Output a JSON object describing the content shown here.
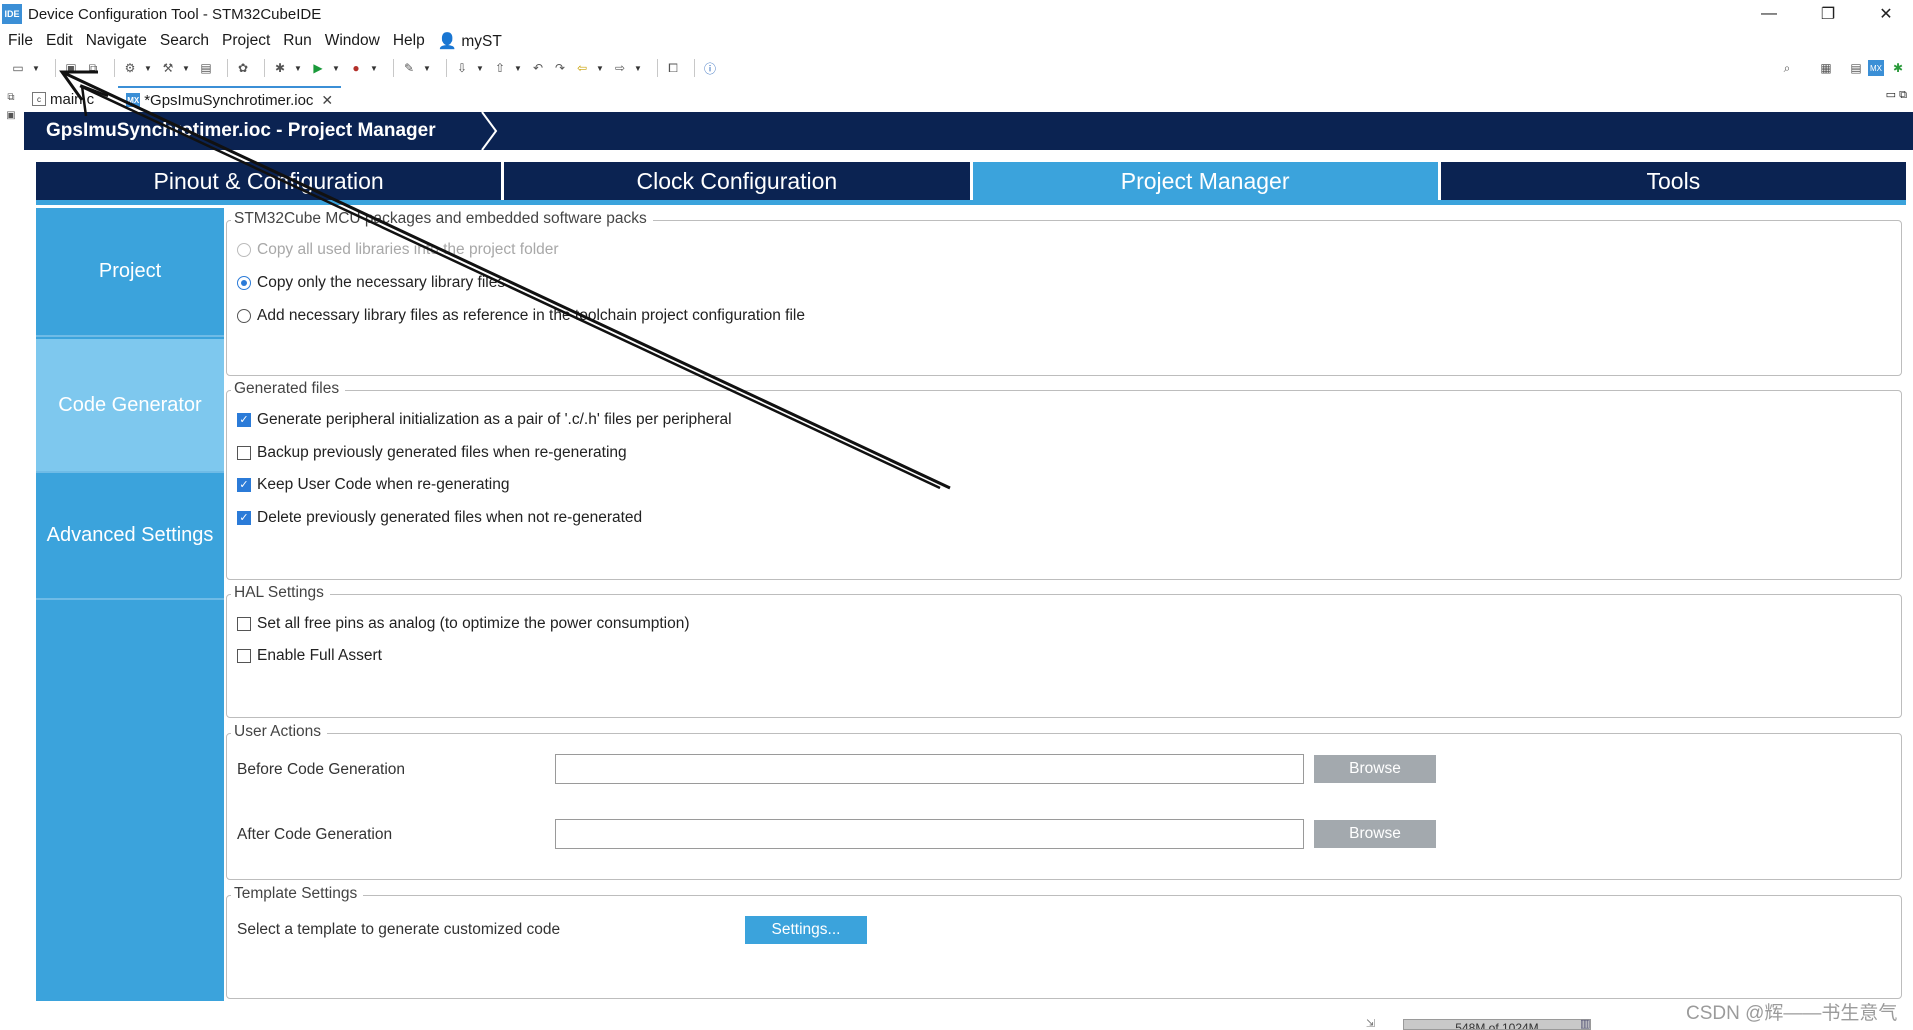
{
  "window": {
    "app_icon_text": "IDE",
    "title": "Device Configuration Tool - STM32CubeIDE",
    "minimize_glyph": "—",
    "maximize_glyph": "❐",
    "close_glyph": "✕"
  },
  "menu": {
    "items": [
      "File",
      "Edit",
      "Navigate",
      "Search",
      "Project",
      "Run",
      "Window",
      "Help"
    ],
    "myst": "myST"
  },
  "toolbar": {
    "icons": [
      "new-icon",
      "save-icon",
      "save-all-icon",
      "build-icon",
      "hammer-icon",
      "debug-icon",
      "run-icon",
      "external-tools-icon",
      "next-annotation-icon",
      "back-icon",
      "forward-icon",
      "open-perspective-icon",
      "info-icon",
      "search-icon"
    ]
  },
  "editor_tabs": {
    "main_tab": "main.c",
    "ioc_tab": "*GpsImuSynchrotimer.ioc",
    "close_glyph": "✕",
    "c_icon_text": "c",
    "mx_icon_text": "MX"
  },
  "header": {
    "breadcrumb": "GpsImuSynchrotimer.ioc - Project Manager"
  },
  "main_tabs": [
    {
      "label": "Pinout & Configuration",
      "active": false
    },
    {
      "label": "Clock Configuration",
      "active": false
    },
    {
      "label": "Project Manager",
      "active": true
    },
    {
      "label": "Tools",
      "active": false
    }
  ],
  "categories": [
    {
      "label": "Project",
      "active": false
    },
    {
      "label": "Code Generator",
      "active": true
    },
    {
      "label": "Advanced Settings",
      "active": false
    }
  ],
  "packages_group": {
    "legend": "STM32Cube MCU packages and embedded software packs",
    "options": [
      {
        "label": "Copy all used libraries into the project folder",
        "selected": false,
        "enabled": false
      },
      {
        "label": "Copy only the necessary library files",
        "selected": true,
        "enabled": true
      },
      {
        "label": "Add necessary library files as reference in the toolchain project configuration file",
        "selected": false,
        "enabled": true
      }
    ]
  },
  "generated_files_group": {
    "legend": "Generated files",
    "options": [
      {
        "label": "Generate peripheral initialization as a pair of '.c/.h' files per peripheral",
        "checked": true
      },
      {
        "label": "Backup previously generated files when re-generating",
        "checked": false
      },
      {
        "label": "Keep User Code when re-generating",
        "checked": true
      },
      {
        "label": "Delete previously generated files when not re-generated",
        "checked": true
      }
    ]
  },
  "hal_group": {
    "legend": "HAL Settings",
    "options": [
      {
        "label": "Set all free pins as analog (to optimize the power consumption)",
        "checked": false
      },
      {
        "label": "Enable Full Assert",
        "checked": false
      }
    ]
  },
  "user_actions_group": {
    "legend": "User Actions",
    "before_label": "Before Code Generation",
    "before_value": "",
    "after_label": "After Code Generation",
    "after_value": "",
    "browse_label": "Browse"
  },
  "template_group": {
    "legend": "Template Settings",
    "label": "Select a template to generate customized code",
    "button": "Settings..."
  },
  "status": {
    "heap": "548M of 1024M",
    "watermark": "CSDN @辉——书生意气"
  },
  "colors": {
    "navy": "#0b2352",
    "accent": "#3ba3dc",
    "active_category": "#7ec8ee",
    "browse_button": "#a3a9ae"
  }
}
